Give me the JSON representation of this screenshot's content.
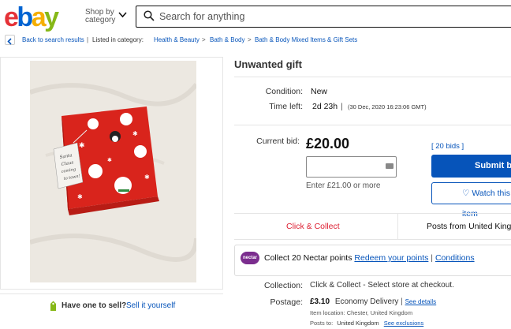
{
  "header": {
    "logo": {
      "e": "e",
      "b": "b",
      "a": "a",
      "y": "y"
    },
    "shop_by_line1": "Shop by",
    "shop_by_line2": "category",
    "search_placeholder": "Search for anything"
  },
  "breadcrumb": {
    "back": "Back to search results",
    "listed_in": "Listed in category:",
    "items": [
      "Health & Beauty",
      "Bath & Body",
      "Bath & Body Mixed Items & Gift Sets"
    ],
    "separator": ">"
  },
  "item": {
    "title": "Unwanted gift",
    "condition_label": "Condition:",
    "condition_value": "New",
    "time_left_label": "Time left:",
    "time_left_value": "2d 23h",
    "time_left_divider": "|",
    "time_left_date": "(30 Dec, 2020  16:23:06 GMT)"
  },
  "bid": {
    "label": "Current bid:",
    "price": "£20.00",
    "bids_link": "[ 20 bids ]",
    "hint": "Enter £21.00 or more",
    "submit_label": "Submit bid",
    "watch_label": "♡ Watch this item"
  },
  "delivery_tabs": {
    "collect": "Click & Collect",
    "posts_from": "Posts from United Kingdom"
  },
  "nectar": {
    "logo_text": "nectar",
    "text": "Collect 20 Nectar points",
    "redeem_link": "Redeem your points",
    "divider": "|",
    "conditions_link": "Conditions"
  },
  "shipping": {
    "collection_label": "Collection:",
    "collection_value": "Click & Collect - Select store at checkout.",
    "postage_label": "Postage:",
    "postage_price": "£3.10",
    "postage_service": "Economy Delivery",
    "see_details": "See details",
    "item_location": "Item location:  Chester, United Kingdom",
    "posts_to_label": "Posts to:",
    "posts_to_value": "United Kingdom",
    "see_exclusions": "See exclusions"
  },
  "sell": {
    "question": "Have one to sell?",
    "link": "Sell it yourself"
  },
  "photo": {
    "tag_text": "Santa Claus coming to town!",
    "colors": {
      "wrap": "#d9241c",
      "background": "#ece8e1",
      "ribbon": "#ffffff",
      "accent": "#2f8a3f"
    }
  },
  "colors": {
    "link": "#0654ba",
    "button": "#0654ba",
    "collect_red": "#dd1e31",
    "nectar": "#7b2d8e"
  }
}
